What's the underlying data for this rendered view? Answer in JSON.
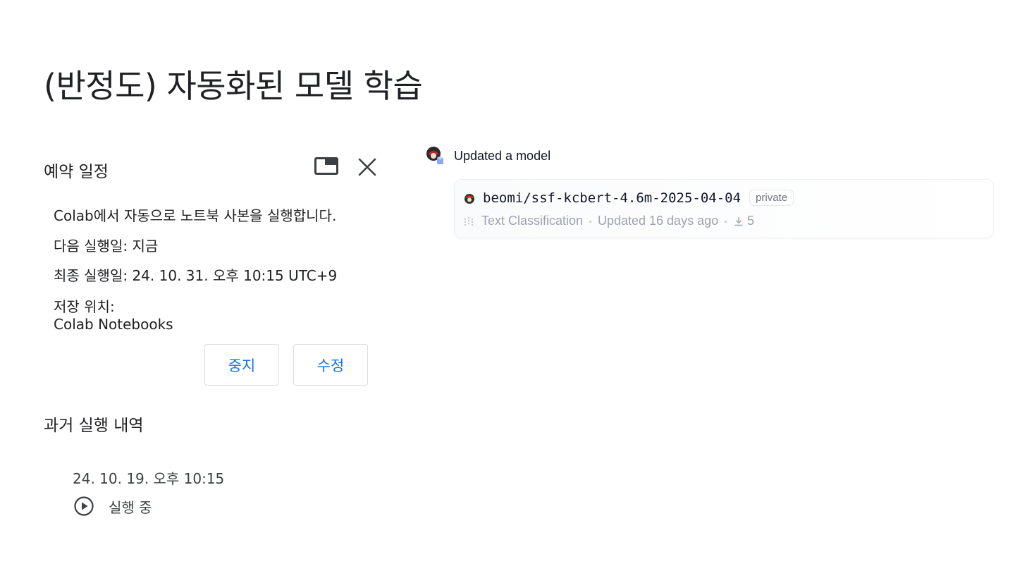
{
  "slide": {
    "title": "(반정도) 자동화된 모델 학습"
  },
  "schedule": {
    "title": "예약 일정",
    "description": "Colab에서 자동으로 노트북 사본을 실행합니다.",
    "next_run": "다음 실행일: 지금",
    "last_run": "최종 실행일: 24. 10. 31. 오후 10:15 UTC+9",
    "location_label": "저장 위치:",
    "location_value": "Colab Notebooks",
    "stop_label": "중지",
    "edit_label": "수정"
  },
  "history": {
    "title": "과거 실행 내역",
    "items": [
      {
        "date": "24. 10. 19. 오후 10:15",
        "status": "실행 중",
        "icon": "play-circle-icon"
      }
    ]
  },
  "activity": {
    "text": "Updated a model",
    "card": {
      "model_name": "beomi/ssf-kcbert-4.6m-2025-04-04",
      "badge": "private",
      "task": "Text Classification",
      "updated": "Updated 16 days ago",
      "downloads": "5"
    }
  },
  "colors": {
    "accent": "#1a73e8",
    "muted": "#9ca3af"
  }
}
